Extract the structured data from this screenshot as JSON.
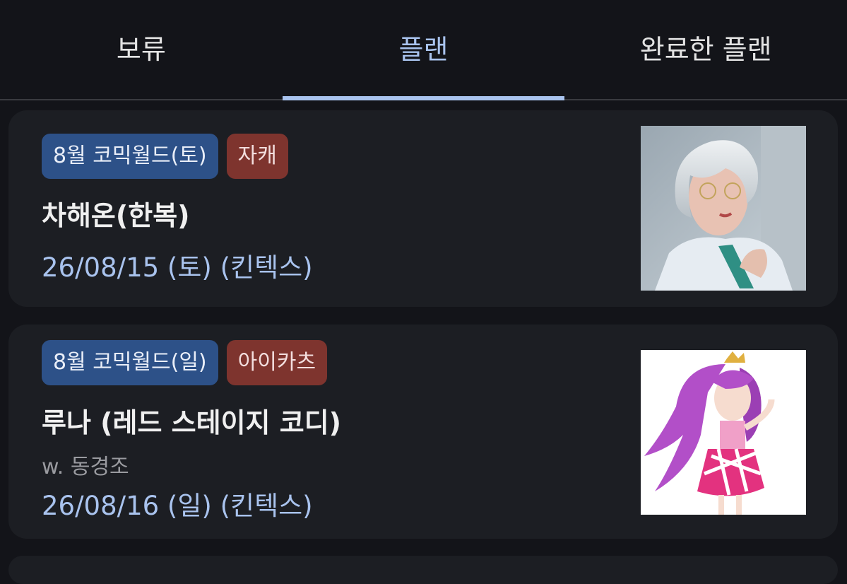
{
  "tabs": [
    {
      "label": "보류",
      "active": false
    },
    {
      "label": "플랜",
      "active": true
    },
    {
      "label": "완료한 플랜",
      "active": false
    }
  ],
  "colors": {
    "accent": "#a9c3ee",
    "background": "#131419",
    "card": "#1c1e23",
    "event_chip": "#2d5188",
    "category_chip": "#7e342e"
  },
  "plans": [
    {
      "event_tag": "8월 코믹월드(토)",
      "category_tag": "자캐",
      "title": "차해온(한복)",
      "date": "26/08/15 (토) (킨텍스)",
      "thumbnail": "cosplay-photo"
    },
    {
      "event_tag": "8월 코믹월드(일)",
      "category_tag": "아이카츠",
      "title": "루나 (레드 스테이지 코디)",
      "with": "w. 동경조",
      "date": "26/08/16 (일) (킨텍스)",
      "thumbnail": "character-illustration"
    }
  ]
}
